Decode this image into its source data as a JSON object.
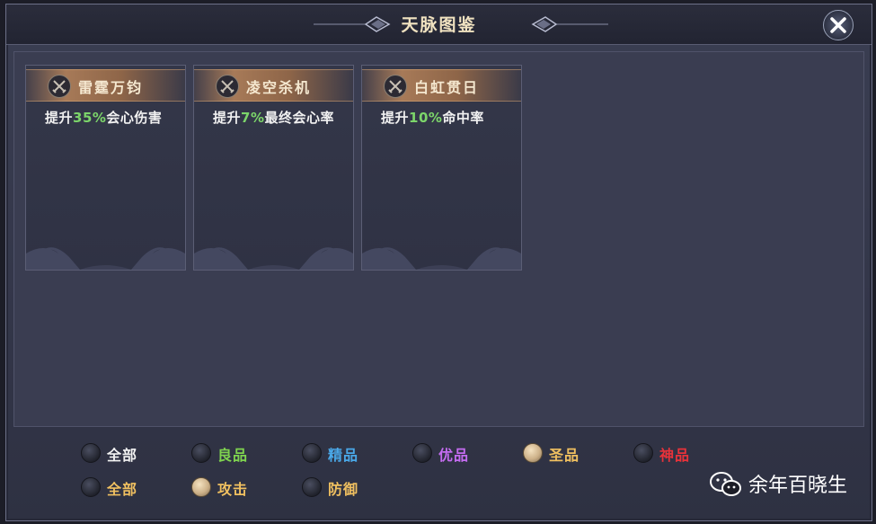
{
  "window": {
    "title": "天脉图鉴"
  },
  "cards": [
    {
      "name": "雷霆万钧",
      "desc_pre": "提升",
      "desc_value": "35%",
      "desc_post": "会心伤害"
    },
    {
      "name": "凌空杀机",
      "desc_pre": "提升",
      "desc_value": "7%",
      "desc_post": "最终会心率"
    },
    {
      "name": "白虹贯日",
      "desc_pre": "提升",
      "desc_value": "10%",
      "desc_post": "命中率"
    }
  ],
  "filters": {
    "quality": [
      {
        "label": "全部",
        "color": "#f2f2f2",
        "selected": false
      },
      {
        "label": "良品",
        "color": "#7fd34f",
        "selected": false
      },
      {
        "label": "精品",
        "color": "#4aa8e8",
        "selected": false
      },
      {
        "label": "优品",
        "color": "#c46cf0",
        "selected": false
      },
      {
        "label": "圣品",
        "color": "#f0c060",
        "selected": true
      },
      {
        "label": "神品",
        "color": "#e8323a",
        "selected": false
      }
    ],
    "type": [
      {
        "label": "全部",
        "color": "#f0c060",
        "selected": false
      },
      {
        "label": "攻击",
        "color": "#f0c060",
        "selected": true
      },
      {
        "label": "防御",
        "color": "#f0c060",
        "selected": false
      }
    ]
  },
  "watermark": {
    "text": "余年百晓生",
    "icon": "wechat-icon"
  },
  "icons": {
    "close": "close-icon",
    "card": "crossed-swords-icon"
  }
}
